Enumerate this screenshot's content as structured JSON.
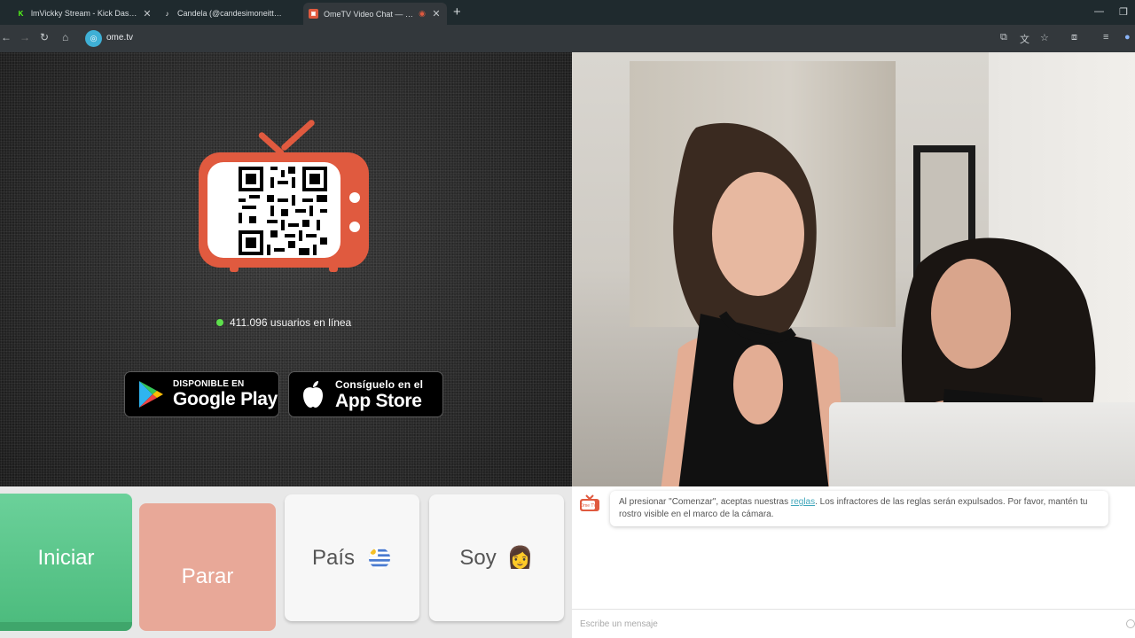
{
  "browser": {
    "tabs": [
      {
        "title": "lmVickky Stream - Kick Dashbo",
        "favicon": "kick-icon"
      },
      {
        "title": "Candela (@candesimoneitt_) |",
        "favicon": "tiktok-icon"
      },
      {
        "title": "OmeTV Video Chat — Ome",
        "favicon": "ometv-icon",
        "active": true
      }
    ],
    "url": "ome.tv"
  },
  "online": {
    "text": "411.096 usuarios en línea",
    "color": "#5ee04c"
  },
  "stores": {
    "google": {
      "small": "DISPONIBLE EN",
      "big": "Google Play"
    },
    "apple": {
      "small": "Consíguelo en el",
      "big": "App Store"
    }
  },
  "controls": {
    "start": "Iniciar",
    "stop": "Parar",
    "country": "País",
    "gender": "Soy",
    "gender_emoji": "👩"
  },
  "chat": {
    "message_before": "Al presionar \"Comenzar\", aceptas nuestras ",
    "message_link": "reglas",
    "message_after": ". Los infractores de las reglas serán expulsados. Por favor, mantén tu rostro visible en el marco de la cámara.",
    "input_placeholder": "Escribe un mensaje",
    "logo_text": "Ome TV"
  },
  "colors": {
    "accent_green": "#4dbc7e",
    "stop_salmon": "#e8a898",
    "brand_red": "#e05a3f",
    "link": "#3fa6bb"
  }
}
